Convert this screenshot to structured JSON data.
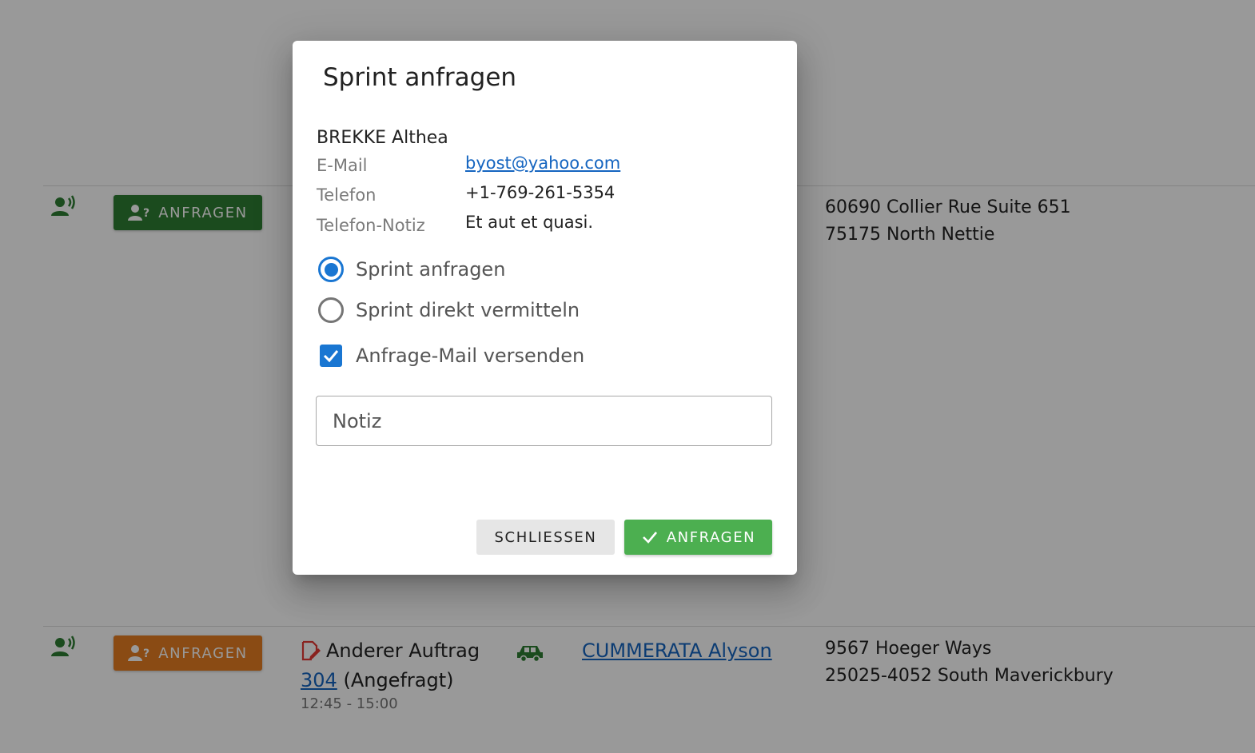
{
  "background": {
    "rows": [
      {
        "request_button": {
          "label": "ANFRAGEN",
          "color": "#2e7d32"
        },
        "address": {
          "line1": "60690 Collier Rue Suite 651",
          "line2": "75175 North Nettie"
        }
      },
      {
        "request_button": {
          "label": "ANFRAGEN",
          "color": "#e67e22"
        },
        "order": {
          "title": "Anderer Auftrag",
          "number": "304",
          "status": "(Angefragt)",
          "time": "12:45 - 15:00"
        },
        "person": "CUMMERATA Alyson",
        "address": {
          "line1": "9567 Hoeger Ways",
          "line2": "25025-4052 South Maverickbury"
        }
      }
    ]
  },
  "dialog": {
    "title": "Sprint anfragen",
    "contact": {
      "name": "BREKKE Althea",
      "fields": [
        {
          "label": "E-Mail",
          "value": "byost@yahoo.com"
        },
        {
          "label": "Telefon",
          "value": "+1-769-261-5354"
        },
        {
          "label": "Telefon-Notiz",
          "value": "Et aut et quasi."
        }
      ]
    },
    "options": [
      {
        "label": "Sprint anfragen",
        "selected": true
      },
      {
        "label": "Sprint direkt vermitteln",
        "selected": false
      }
    ],
    "send_mail": {
      "label": "Anfrage-Mail versenden",
      "checked": true
    },
    "note": {
      "placeholder": "Notiz",
      "value": ""
    },
    "buttons": {
      "close": "SCHLIESSEN",
      "submit": "ANFRAGEN"
    }
  },
  "colors": {
    "primary": "#1976d2",
    "success": "#4caf50",
    "link": "#1565c0",
    "row_icon": "#2e7d32",
    "order_icon": "#e53935"
  }
}
